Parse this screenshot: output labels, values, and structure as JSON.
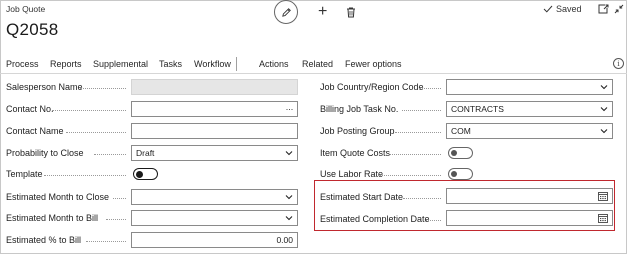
{
  "header": {
    "entity_type": "Job Quote",
    "title": "Q2058",
    "saved_label": "Saved",
    "plus_symbol": "+"
  },
  "actions": [
    "Process",
    "Reports",
    "Supplemental",
    "Tasks",
    "Workflow",
    "Actions",
    "Related",
    "Fewer options"
  ],
  "info_symbol": "i",
  "left_fields": {
    "salesperson_name": {
      "label": "Salesperson Name",
      "value": ""
    },
    "contact_no": {
      "label": "Contact No.",
      "value": "",
      "button": "···"
    },
    "contact_name": {
      "label": "Contact Name",
      "value": ""
    },
    "probability_to_close": {
      "label": "Probability to Close",
      "value": "Draft"
    },
    "template": {
      "label": "Template",
      "toggle_on": false
    },
    "estimated_month_to_close": {
      "label": "Estimated Month to Close",
      "value": ""
    },
    "estimated_month_to_bill": {
      "label": "Estimated Month to Bill",
      "value": ""
    },
    "estimated_pct_to_bill": {
      "label": "Estimated % to Bill",
      "value": "0.00"
    }
  },
  "right_fields": {
    "job_country_region_code": {
      "label": "Job Country/Region Code",
      "value": ""
    },
    "billing_job_task_no": {
      "label": "Billing Job Task No.",
      "value": "CONTRACTS"
    },
    "job_posting_group": {
      "label": "Job Posting Group",
      "value": "COM"
    },
    "item_quote_costs": {
      "label": "Item Quote Costs",
      "toggle_on": false
    },
    "use_labor_rate": {
      "label": "Use Labor Rate",
      "toggle_on": false
    },
    "estimated_start_date": {
      "label": "Estimated Start Date",
      "value": ""
    },
    "estimated_completion_date": {
      "label": "Estimated Completion Date",
      "value": ""
    }
  },
  "colors": {
    "highlight_border": "#c0282e",
    "disabled_field": "#e6e6e6"
  }
}
